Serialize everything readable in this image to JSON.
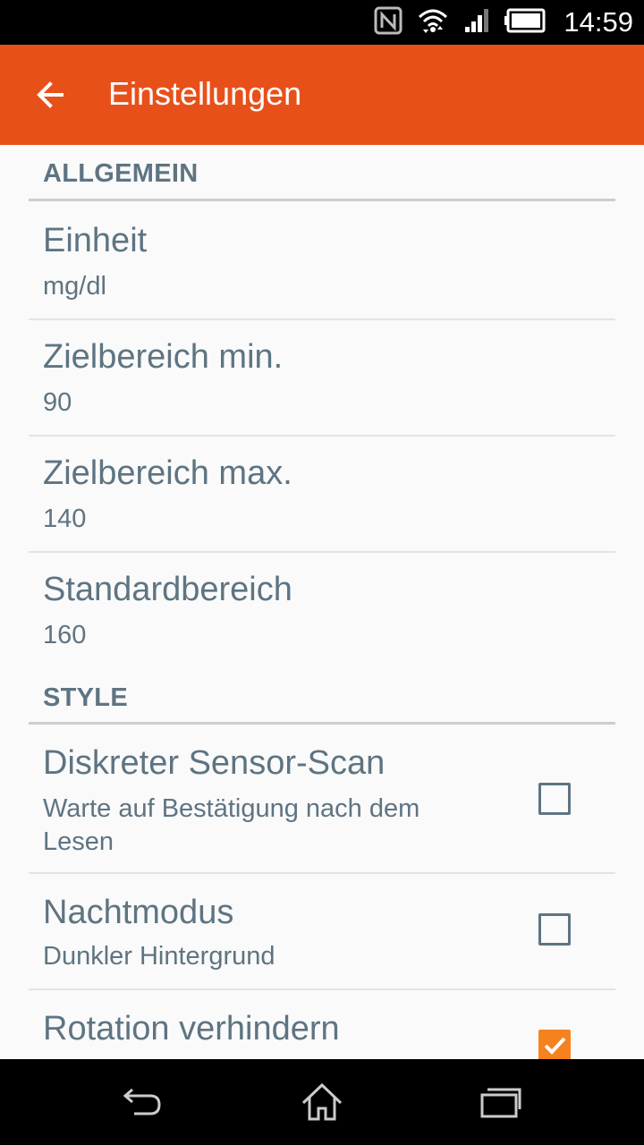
{
  "status_bar": {
    "time": "14:59",
    "icons": [
      "nfc-icon",
      "wifi-icon",
      "signal-icon",
      "battery-icon"
    ]
  },
  "app_bar": {
    "back_icon": "arrow-left-icon",
    "title": "Einstellungen",
    "color": "#e8501a"
  },
  "sections": [
    {
      "header": "ALLGEMEIN",
      "items": [
        {
          "title": "Einheit",
          "summary": "mg/dl"
        },
        {
          "title": "Zielbereich min.",
          "summary": "90"
        },
        {
          "title": "Zielbereich max.",
          "summary": "140"
        },
        {
          "title": "Standardbereich",
          "summary": "160"
        }
      ]
    },
    {
      "header": "STYLE",
      "items": [
        {
          "title": "Diskreter Sensor-Scan",
          "summary": "Warte auf Bestätigung nach dem Lesen",
          "checked": false
        },
        {
          "title": "Nachtmodus",
          "summary": "Dunkler Hintergrund",
          "checked": false
        },
        {
          "title": "Rotation verhindern",
          "checked": true
        }
      ]
    }
  ],
  "nav_bar": {
    "icons": [
      "back-icon",
      "home-icon",
      "recents-icon"
    ]
  },
  "colors": {
    "text": "#5e7482",
    "accent": "#f5821f"
  }
}
